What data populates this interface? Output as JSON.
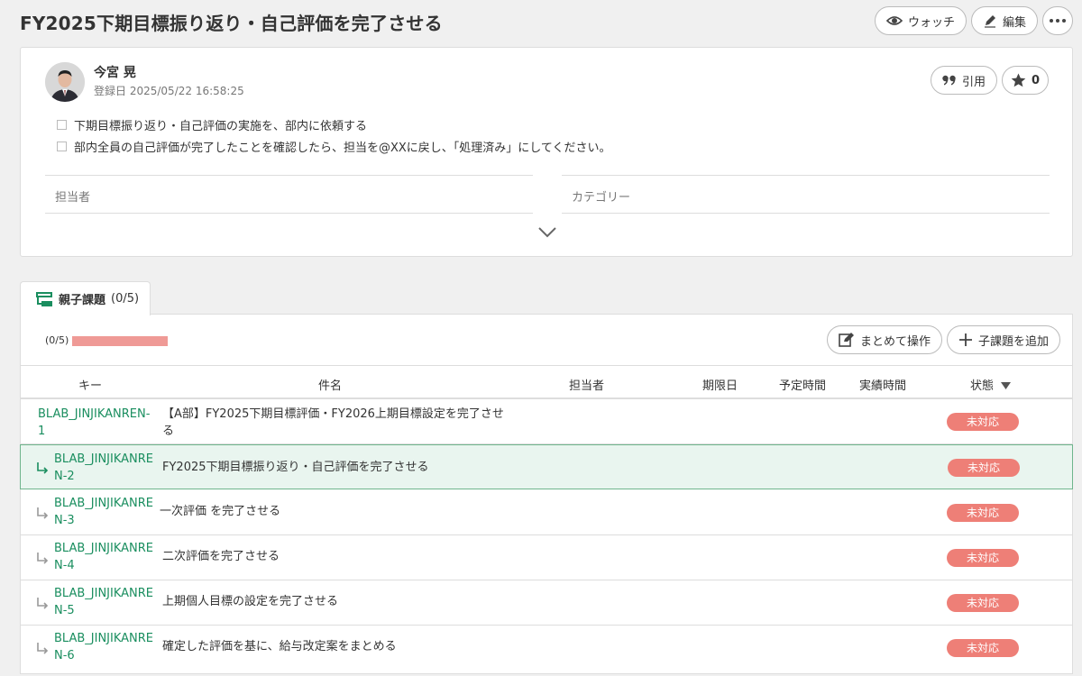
{
  "page": {
    "title": "FY2025下期目標振り返り・自己評価を完了させる",
    "watch_label": "ウォッチ",
    "edit_label": "編集"
  },
  "issue": {
    "author_name": "今宮 晃",
    "registered_label": "登録日",
    "registered_date": "2025/05/22 16:58:25",
    "quote_label": "引用",
    "star_count": "0",
    "checklist": [
      "下期目標振り返り・自己評価の実施を、部内に依頼する",
      "部内全員の自己評価が完了したことを確認したら、担当を@XXに戻し、「処理済み」にしてください。"
    ],
    "assignee_label": "担当者",
    "category_label": "カテゴリー"
  },
  "child_issues": {
    "tab_label": "親子課題",
    "tab_count": "(0/5)",
    "progress_label": "(0/5)",
    "progress_fraction": 0,
    "bulk_action_label": "まとめて操作",
    "add_child_label": "子課題を追加",
    "columns": [
      "キー",
      "件名",
      "担当者",
      "期限日",
      "予定時間",
      "実績時間",
      "状態"
    ],
    "rows": [
      {
        "key_line1": "BLAB_JINJIKANREN-",
        "key_line2": "1",
        "subject": "【A部】FY2025下期目標評価・FY2026上期目標設定を完了させる",
        "status": "未対応"
      },
      {
        "key_line1": "BLAB_JINJIKANRE",
        "key_line2": "N-2",
        "subject": "FY2025下期目標振り返り・自己評価を完了させる",
        "status": "未対応"
      },
      {
        "key_line1": "BLAB_JINJIKANRE",
        "key_line2": "N-3",
        "subject": "一次評価 を完了させる",
        "status": "未対応"
      },
      {
        "key_line1": "BLAB_JINJIKANRE",
        "key_line2": "N-4",
        "subject": "二次評価を完了させる",
        "status": "未対応"
      },
      {
        "key_line1": "BLAB_JINJIKANRE",
        "key_line2": "N-5",
        "subject": "上期個人目標の設定を完了させる",
        "status": "未対応"
      },
      {
        "key_line1": "BLAB_JINJIKANRE",
        "key_line2": "N-6",
        "subject": "確定した評価を基に、給与改定案をまとめる",
        "status": "未対応"
      }
    ]
  },
  "colors": {
    "accent_green": "#1a8e5f",
    "status_open": "#ee7f77",
    "progress": "#ef9a96",
    "selected_row": "#e9f5ef"
  },
  "icons": [
    "eye-icon",
    "pencil-icon",
    "more-icon",
    "quote-icon",
    "star-icon",
    "tree-icon",
    "bulk-edit-icon",
    "plus-icon",
    "chevron-down-icon",
    "child-arrow-icon",
    "sort-down-icon"
  ]
}
